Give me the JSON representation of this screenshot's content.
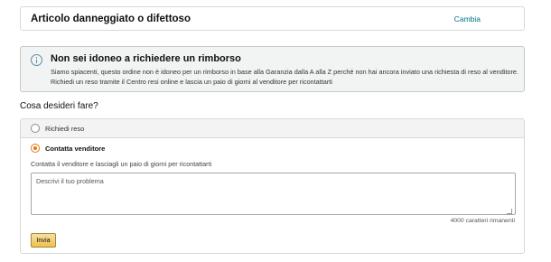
{
  "reason": {
    "title": "Articolo danneggiato o difettoso",
    "change_link": "Cambia"
  },
  "alert": {
    "icon": "info-icon",
    "title": "Non sei idoneo a richiedere un rimborso",
    "line1": "Siamo spiacenti, questo ordine non è idoneo per un rimborso in base alla Garanzia dalla A alla Z perché non hai ancora inviato una richiesta di reso al venditore.",
    "line2": "Richiedi un reso tramite il Centro resi online e lascia un paio di giorni al venditore per ricontattarti"
  },
  "question": "Cosa desideri fare?",
  "options": [
    {
      "label": "Richiedi reso",
      "selected": false
    },
    {
      "label": "Contatta venditore",
      "selected": true
    }
  ],
  "contact": {
    "description": "Contatta il venditore e lasciagli un paio di giorni per ricontattarti",
    "textarea_placeholder": "Descrivi il tuo problema",
    "textarea_value": "",
    "counter": "4000 caratteri rimanenti",
    "submit_label": "Invia"
  },
  "colors": {
    "link": "#007185",
    "radio_selected": "#e3780c",
    "button": "#f0c14b",
    "info_icon": "#5e8ba3"
  }
}
